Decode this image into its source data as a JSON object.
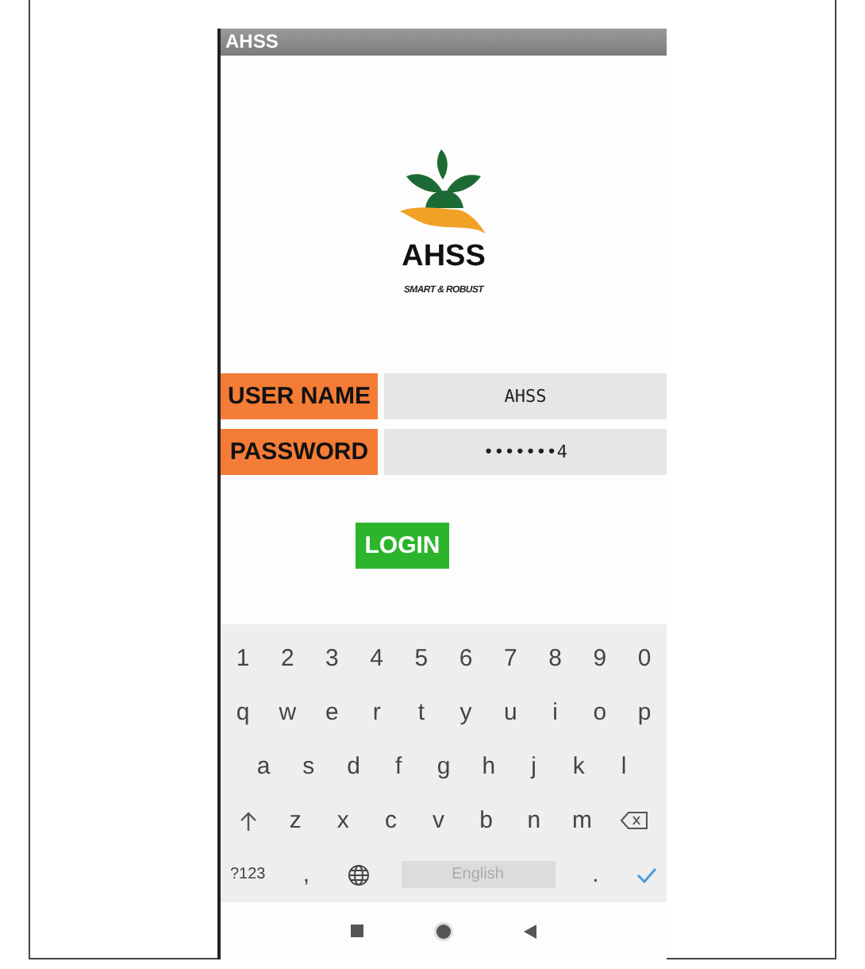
{
  "window": {
    "title": "AHSS"
  },
  "logo": {
    "name": "AHSS",
    "tagline": "SMART & ROBUST"
  },
  "fields": [
    {
      "label": "USER NAME",
      "value": "AHSS"
    },
    {
      "label": "PASSWORD",
      "value": "•••••••4"
    }
  ],
  "login_button": "LOGIN",
  "keyboard": {
    "rows": [
      [
        {
          "kind": "char",
          "label": "1"
        },
        {
          "kind": "char",
          "label": "2"
        },
        {
          "kind": "char",
          "label": "3"
        },
        {
          "kind": "char",
          "label": "4"
        },
        {
          "kind": "char",
          "label": "5"
        },
        {
          "kind": "char",
          "label": "6"
        },
        {
          "kind": "char",
          "label": "7"
        },
        {
          "kind": "char",
          "label": "8"
        },
        {
          "kind": "char",
          "label": "9"
        },
        {
          "kind": "char",
          "label": "0"
        }
      ],
      [
        {
          "kind": "char",
          "label": "q"
        },
        {
          "kind": "char",
          "label": "w"
        },
        {
          "kind": "char",
          "label": "e"
        },
        {
          "kind": "char",
          "label": "r"
        },
        {
          "kind": "char",
          "label": "t"
        },
        {
          "kind": "char",
          "label": "y"
        },
        {
          "kind": "char",
          "label": "u"
        },
        {
          "kind": "char",
          "label": "i"
        },
        {
          "kind": "char",
          "label": "o"
        },
        {
          "kind": "char",
          "label": "p"
        }
      ],
      [
        {
          "kind": "char",
          "label": "a"
        },
        {
          "kind": "char",
          "label": "s"
        },
        {
          "kind": "char",
          "label": "d"
        },
        {
          "kind": "char",
          "label": "f"
        },
        {
          "kind": "char",
          "label": "g"
        },
        {
          "kind": "char",
          "label": "h"
        },
        {
          "kind": "char",
          "label": "j"
        },
        {
          "kind": "char",
          "label": "k"
        },
        {
          "kind": "char",
          "label": "l"
        }
      ],
      [
        {
          "kind": "shift"
        },
        {
          "kind": "char",
          "label": "z"
        },
        {
          "kind": "char",
          "label": "x"
        },
        {
          "kind": "char",
          "label": "c"
        },
        {
          "kind": "char",
          "label": "v"
        },
        {
          "kind": "char",
          "label": "b"
        },
        {
          "kind": "char",
          "label": "n"
        },
        {
          "kind": "char",
          "label": "m"
        },
        {
          "kind": "backspace"
        }
      ]
    ],
    "bottom_row": {
      "symbols_key": "?123",
      "comma_key": ",",
      "space_bar": "English",
      "period_key": "."
    }
  }
}
